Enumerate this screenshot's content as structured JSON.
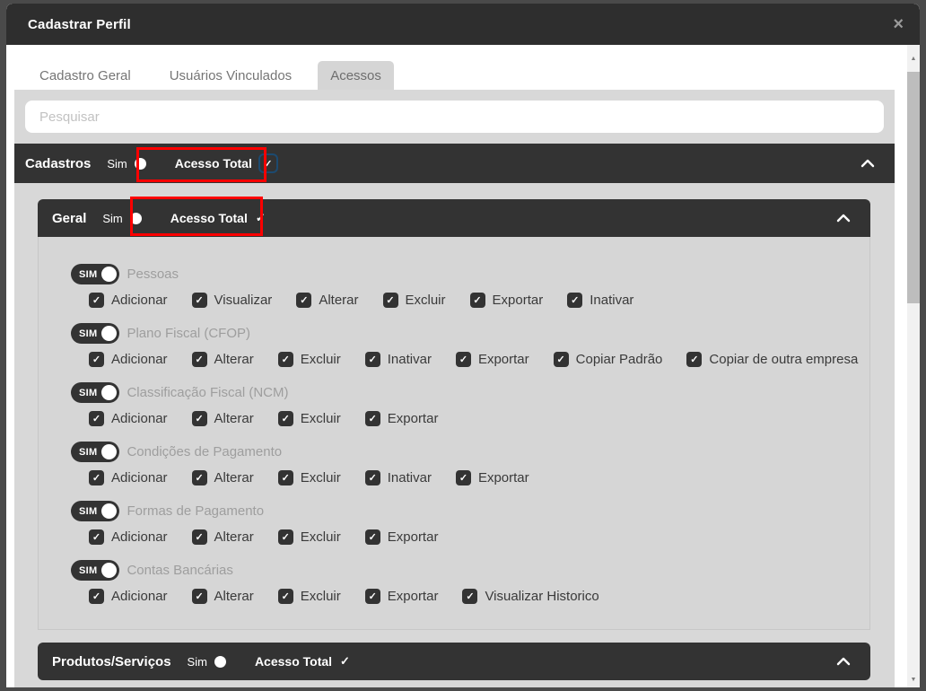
{
  "modal": {
    "title": "Cadastrar Perfil",
    "close_icon": "×",
    "tabs": [
      {
        "label": "Cadastro Geral",
        "active": false
      },
      {
        "label": "Usuários Vinculados",
        "active": false
      },
      {
        "label": "Acessos",
        "active": true
      }
    ],
    "search": {
      "placeholder": "Pesquisar"
    }
  },
  "section": {
    "title": "Cadastros",
    "toggle_label": "Sim",
    "access_label": "Acesso Total",
    "access_checked": "✓",
    "subsections": [
      {
        "title": "Geral",
        "toggle_label": "Sim",
        "access_label": "Acesso Total",
        "access_checked": "✓",
        "rows": [
          {
            "toggle": "SIM",
            "label": "Pessoas",
            "permissions": [
              "Adicionar",
              "Visualizar",
              "Alterar",
              "Excluir",
              "Exportar",
              "Inativar"
            ]
          },
          {
            "toggle": "SIM",
            "label": "Plano Fiscal (CFOP)",
            "permissions": [
              "Adicionar",
              "Alterar",
              "Excluir",
              "Inativar",
              "Exportar",
              "Copiar Padrão",
              "Copiar de outra empresa"
            ]
          },
          {
            "toggle": "SIM",
            "label": "Classificação Fiscal (NCM)",
            "permissions": [
              "Adicionar",
              "Alterar",
              "Excluir",
              "Exportar"
            ]
          },
          {
            "toggle": "SIM",
            "label": "Condições de Pagamento",
            "permissions": [
              "Adicionar",
              "Alterar",
              "Excluir",
              "Inativar",
              "Exportar"
            ]
          },
          {
            "toggle": "SIM",
            "label": "Formas de Pagamento",
            "permissions": [
              "Adicionar",
              "Alterar",
              "Excluir",
              "Exportar"
            ]
          },
          {
            "toggle": "SIM",
            "label": "Contas Bancárias",
            "permissions": [
              "Adicionar",
              "Alterar",
              "Excluir",
              "Exportar",
              "Visualizar Historico"
            ]
          }
        ]
      },
      {
        "title": "Produtos/Serviços",
        "toggle_label": "Sim",
        "access_label": "Acesso Total",
        "access_checked": "✓"
      }
    ]
  },
  "colors": {
    "overlay": "#4a4a4a",
    "bar_dark": "#333333",
    "body_grey": "#d8d8d8",
    "active_tab": "#d5d5d5",
    "highlight_red": "#fe0000",
    "focus_ring_blue": "#1c4a70"
  }
}
